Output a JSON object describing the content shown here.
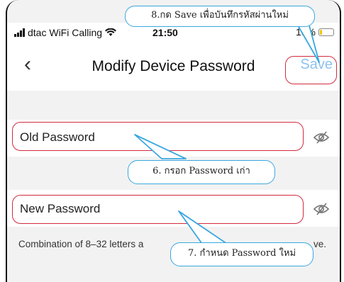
{
  "status_bar": {
    "carrier": "dtac WiFi Calling",
    "time": "21:50",
    "battery_percent": "19%",
    "battery_level": 0.19
  },
  "nav": {
    "title": "Modify Device Password",
    "save_label": "Save"
  },
  "form": {
    "old_password_placeholder": "Old Password",
    "new_password_placeholder": "New Password",
    "hint_text_left": "Combination of 8–32 letters a",
    "hint_text_right": "ve."
  },
  "annotations": {
    "save": "8.กด Save เพื่อบันทึกรหัสผ่านใหม่",
    "old_password": "6. กรอก Password เก่า",
    "new_password": "7. กำหนด Password ใหม่"
  },
  "colors": {
    "highlight": "#d22b3d",
    "callout_border": "#3aa7e0",
    "save_text": "#8ec2ee",
    "battery": "#f5c400"
  }
}
